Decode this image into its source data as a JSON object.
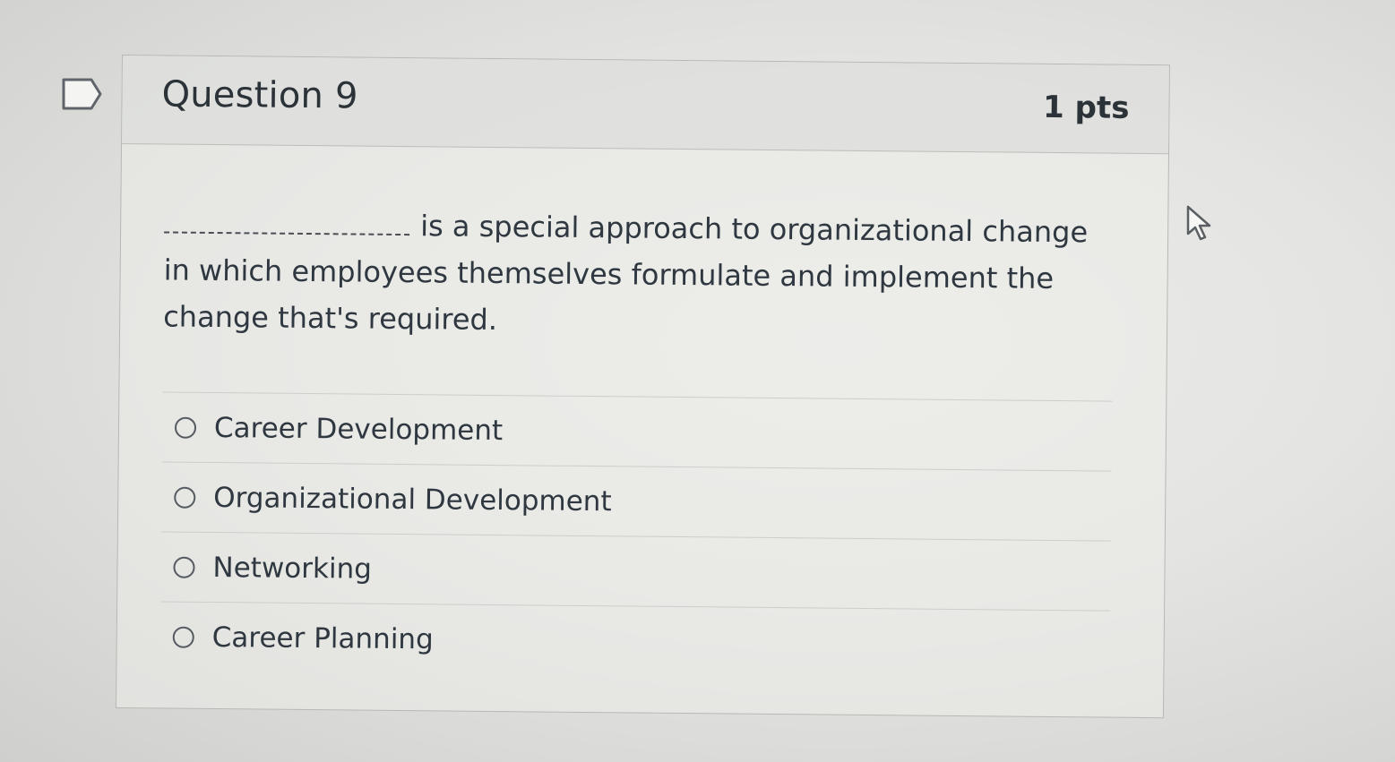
{
  "question": {
    "title": "Question 9",
    "points": "1 pts",
    "text": "is a special approach to organizational change in which employees themselves formulate and implement the change that's required.",
    "blank": "________________",
    "answers": [
      {
        "label": "Career Development",
        "selected": false
      },
      {
        "label": "Organizational Development",
        "selected": false
      },
      {
        "label": "Networking",
        "selected": false
      },
      {
        "label": "Career Planning",
        "selected": false
      }
    ]
  },
  "icons": {
    "flag": "flag-outline-icon",
    "cursor": "mouse-pointer-icon"
  },
  "colors": {
    "background": "#e4e4e2",
    "header": "#dcdddb",
    "border": "#b7b7b5",
    "text": "#2f3840"
  }
}
